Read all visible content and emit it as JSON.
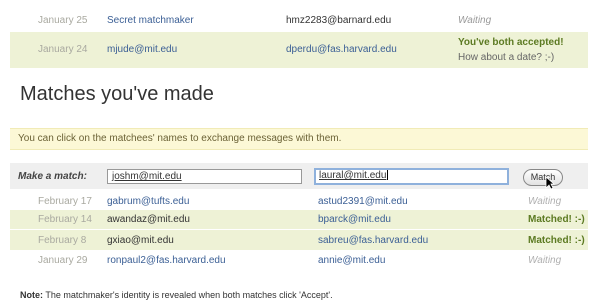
{
  "requests": [
    {
      "date": "January 25",
      "from": "Secret matchmaker",
      "to": "hmz2283@barnard.edu",
      "status": "Waiting",
      "status2": ""
    },
    {
      "date": "January 24",
      "from": "mjude@mit.edu",
      "to": "dperdu@fas.harvard.edu",
      "status": "You've both accepted!",
      "status2": "How about a date? ;-)"
    }
  ],
  "matches_section": {
    "title": "Matches you've made",
    "info": "You can click on the matchees' names to exchange messages with them."
  },
  "make_match": {
    "label": "Make a match:",
    "first_value": "joshm@mit.edu",
    "second_value": "laural@mit.edu",
    "button": "Match"
  },
  "matches": [
    {
      "date": "February 17",
      "first": "gabrum@tufts.edu",
      "second": "astud2391@mit.edu",
      "status": "Waiting",
      "kind": "waiting"
    },
    {
      "date": "February 14",
      "first": "awandaz@mit.edu",
      "second": "bparck@mit.edu",
      "status": "Matched! :-)",
      "kind": "matched"
    },
    {
      "date": "February 8",
      "first": "gxiao@mit.edu",
      "second": "sabreu@fas.harvard.edu",
      "status": "Matched! :-)",
      "kind": "matched"
    },
    {
      "date": "January 29",
      "first": "ronpaul2@fas.harvard.edu",
      "second": "annie@mit.edu",
      "status": "Waiting",
      "kind": "waiting"
    }
  ],
  "note": {
    "label": "Note:",
    "text": " The matchmaker's identity is revealed when both matches click 'Accept'."
  }
}
